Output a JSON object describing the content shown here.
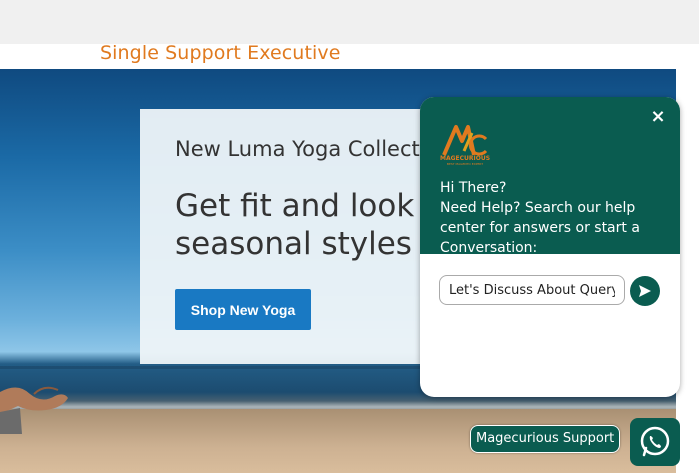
{
  "header": {
    "title": "Single Support Executive"
  },
  "promo": {
    "collection_title": "New Luma Yoga Collection",
    "headline": "Get fit and look fab in new seasonal styles",
    "button_label": "Shop New Yoga"
  },
  "chat": {
    "close_label": "×",
    "logo_text": "MAGECURIOUS",
    "logo_subtext": "BEST MAGENTO EXPERT",
    "greeting": "Hi There?",
    "help_text": "Need Help? Search our help center for answers or start a Conversation:",
    "input_value": "Let's Discuss About Query"
  },
  "footer_widget": {
    "support_label": "Magecurious Support"
  },
  "colors": {
    "accent_orange": "#e07a1f",
    "chat_green": "#0a5c50",
    "button_blue": "#1979c3"
  },
  "icons": [
    "close-icon",
    "send-icon",
    "whatsapp-icon",
    "magecurious-logo"
  ]
}
